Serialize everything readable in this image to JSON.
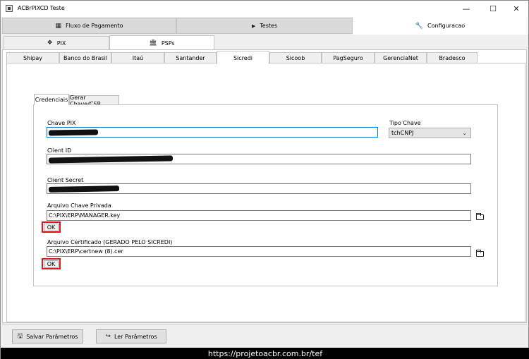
{
  "window": {
    "title": "ACBrPIXCD Teste",
    "minimize_glyph": "—",
    "maximize_glyph": "☐",
    "close_glyph": "✕"
  },
  "main_tabs": [
    {
      "label": "Fluxo de Pagamento",
      "icon": "grid-icon",
      "icon_glyph": "▦"
    },
    {
      "label": "Testes",
      "icon": "play-icon",
      "icon_glyph": "▶"
    },
    {
      "label": "Configuracao",
      "icon": "wrench-icon",
      "icon_glyph": "🔧"
    }
  ],
  "sub_tabs": [
    {
      "label": "PIX",
      "icon": "pix-icon",
      "icon_glyph": "❖"
    },
    {
      "label": "PSPs",
      "icon": "bank-icon",
      "icon_glyph": "🏛"
    }
  ],
  "psp_tabs": [
    "Shipay",
    "Banco do Brasil",
    "Itaú",
    "Santander",
    "Sicredi",
    "Sicoob",
    "PagSeguro",
    "GerenciaNet",
    "Bradesco"
  ],
  "inner_tabs": [
    "Credenciais",
    "Gerar Chave/CSR"
  ],
  "form": {
    "chave_pix_label": "Chave PIX",
    "tipo_chave_label": "Tipo Chave",
    "tipo_chave_value": "tchCNPJ",
    "client_id_label": "Client ID",
    "client_secret_label": "Client Secret",
    "arquivo_chave_label": "Arquivo Chave Privada",
    "arquivo_chave_value": "C:\\PIX\\ERP\\MANAGER.key",
    "arquivo_cert_label": "Arquivo Certificado (GERADO PELO SICREDI)",
    "arquivo_cert_value": "C:\\PIX\\ERP\\certnew (8).cer",
    "ok_label": "OK"
  },
  "buttons": {
    "salvar": "Salvar Parâmetros",
    "ler": "Ler Parâmetros"
  },
  "footer_text": "https://projetoacbr.com.br/tef",
  "colors": {
    "highlight_red": "#e0161e",
    "focus_blue": "#0078d7"
  }
}
